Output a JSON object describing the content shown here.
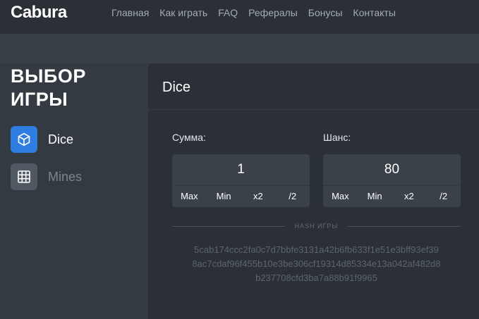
{
  "header": {
    "logo": "Cabura",
    "nav": [
      "Главная",
      "Как играть",
      "FAQ",
      "Рефералы",
      "Бонусы",
      "Контакты"
    ]
  },
  "sidebar": {
    "title": "ВЫБОР ИГРЫ",
    "games": [
      {
        "label": "Dice",
        "icon": "cube-icon",
        "active": true
      },
      {
        "label": "Mines",
        "icon": "grid-icon",
        "active": false
      }
    ]
  },
  "panel": {
    "title": "Dice",
    "amount": {
      "label": "Сумма:",
      "value": "1",
      "buttons": [
        "Max",
        "Min",
        "x2",
        "/2"
      ]
    },
    "chance": {
      "label": "Шанс:",
      "value": "80",
      "buttons": [
        "Max",
        "Min",
        "x2",
        "/2"
      ]
    },
    "hash_title": "HASH ИГРЫ",
    "hash_lines": [
      "5cab174ccc2fa0c7d7bbfe3131a42b6fb633f1e51e3bff93ef39",
      "8ac7cdaf96f455b10e3be306cf19314d85334e13a042af482d8",
      "b237708cfd3ba7a88b91f9965"
    ]
  },
  "colors": {
    "accent": "#2f7de1",
    "background": "#343a42",
    "panel": "#2b3037"
  }
}
